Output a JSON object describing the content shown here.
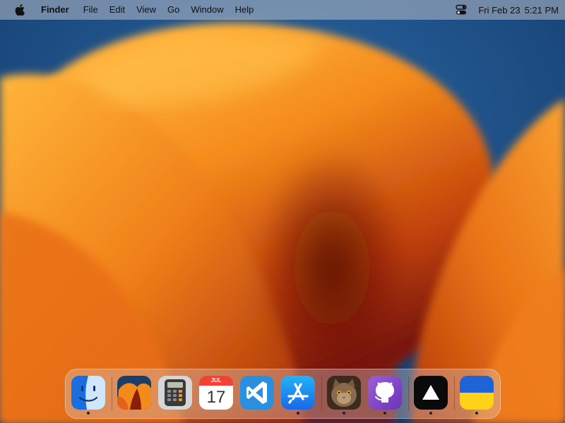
{
  "menubar": {
    "app_name": "Finder",
    "items": [
      "File",
      "Edit",
      "View",
      "Go",
      "Window",
      "Help"
    ],
    "date": "Fri Feb 23",
    "time": "5:21 PM"
  },
  "dock": {
    "apps": [
      {
        "name": "finder-app-icon",
        "running": true
      },
      {
        "name": "wallpaper-app-icon",
        "running": false
      },
      {
        "name": "calculator-app-icon",
        "running": false
      },
      {
        "name": "calendar-app-icon",
        "running": false,
        "month": "JUL",
        "day": "17"
      },
      {
        "name": "vscode-app-icon",
        "running": false
      },
      {
        "name": "app-store-icon",
        "running": true
      },
      {
        "name": "cat-photo-app-icon",
        "running": true
      },
      {
        "name": "github-app-icon",
        "running": true
      },
      {
        "name": "triangle-app-icon",
        "running": true
      },
      {
        "name": "ukraine-flag-app-icon",
        "running": true
      }
    ]
  },
  "colors": {
    "wallpaper_blue": "#1b4f86",
    "wallpaper_orange": "#f28a1c",
    "dock_dot": "#222222"
  }
}
